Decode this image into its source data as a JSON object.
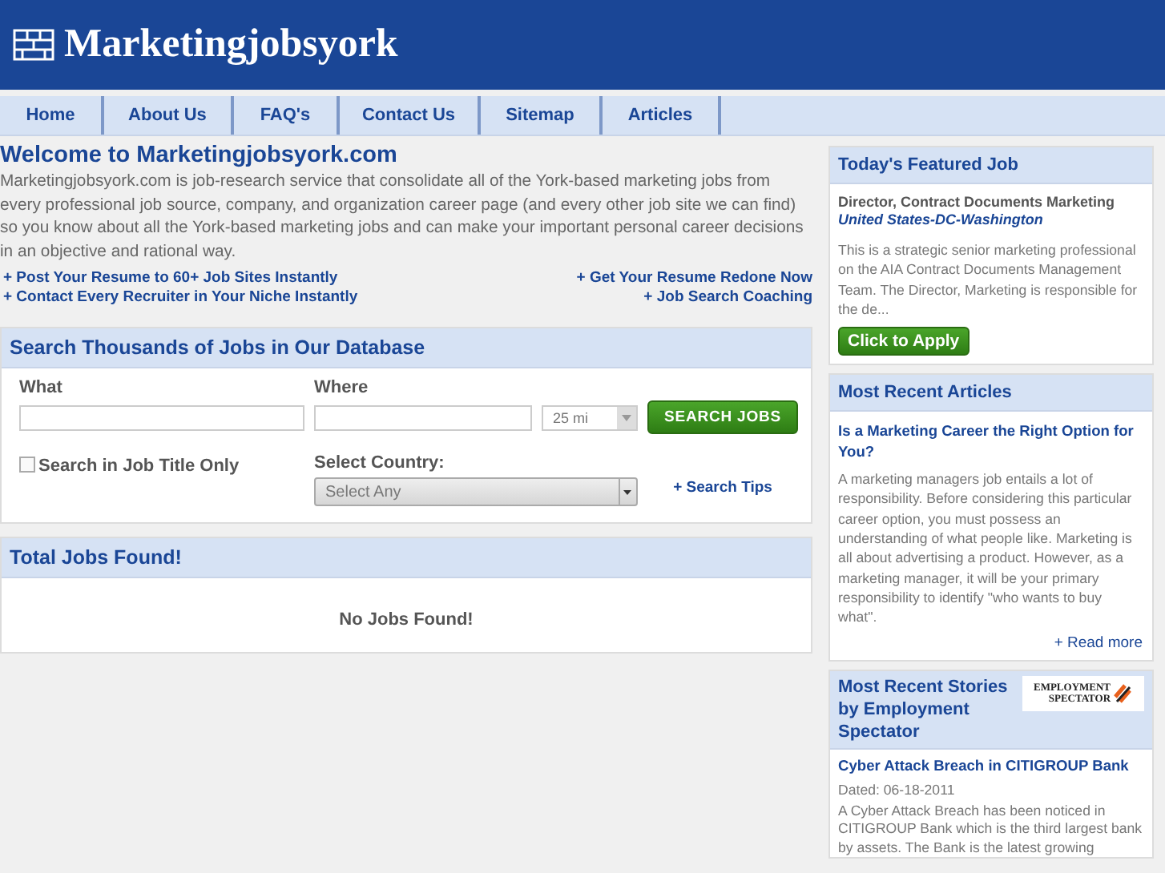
{
  "site": {
    "title": "Marketingjobsyork"
  },
  "nav": [
    {
      "label": "Home"
    },
    {
      "label": "About Us"
    },
    {
      "label": "FAQ's"
    },
    {
      "label": "Contact Us"
    },
    {
      "label": "Sitemap"
    },
    {
      "label": "Articles"
    }
  ],
  "welcome": {
    "heading": "Welcome to Marketingjobsyork.com",
    "text": "Marketingjobsyork.com is job-research service that consolidate all of the York-based marketing jobs from every professional job source, company, and organization career page (and every other job site we can find) so you know about all the York-based marketing jobs and can make your important personal career decisions in an objective and rational way.",
    "links": [
      {
        "label": "+ Post Your Resume to 60+ Job Sites Instantly"
      },
      {
        "label": "+ Get Your Resume Redone Now"
      },
      {
        "label": "+ Contact Every Recruiter in Your Niche Instantly"
      },
      {
        "label": "+ Job Search Coaching"
      }
    ]
  },
  "search": {
    "heading": "Search Thousands of Jobs in Our Database",
    "what_label": "What",
    "where_label": "Where",
    "distance": "25 mi",
    "button": "SEARCH JOBS",
    "title_only": {
      "label": "Search in Job Title Only",
      "checked": false
    },
    "country_label": "Select Country:",
    "country": "Select Any",
    "tips": "+ Search Tips"
  },
  "results": {
    "heading": "Total Jobs Found!",
    "message": "No Jobs Found!"
  },
  "featured": {
    "heading": "Today's Featured Job",
    "job_title": "Director, Contract Documents Marketing",
    "location": "United States-DC-Washington",
    "summary": "This is a strategic senior marketing professional on the AIA Contract Documents Management Team. The Director, Marketing is responsible for the de...",
    "button": "Click to Apply"
  },
  "articles": {
    "heading": "Most Recent Articles",
    "title": "Is a Marketing Career the Right Option for You?",
    "summary": "A marketing managers job entails a lot of responsibility. Before considering this particular career option, you must possess an understanding of what people like. Marketing is all about advertising a product. However, as a marketing manager, it will be your primary responsibility to identify \"who wants to buy what\".",
    "read_more": "+ Read more"
  },
  "stories": {
    "heading": "Most Recent Stories by Employment Spectator",
    "logo_lines": [
      "EMPLOYMENT",
      "SPECTATOR"
    ],
    "title": "Cyber Attack Breach in CITIGROUP Bank",
    "date": "Dated: 06-18-2011",
    "summary": "A Cyber Attack Breach has been noticed in CITIGROUP Bank which is the third largest bank by assets. The Bank is the latest growing"
  }
}
